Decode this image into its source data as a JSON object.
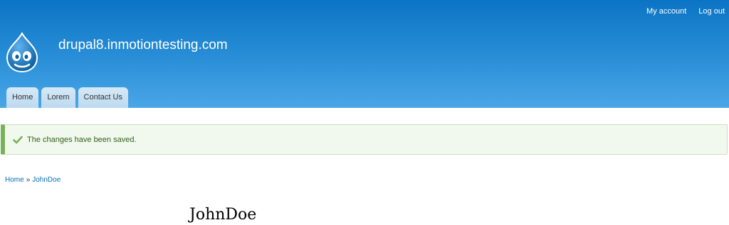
{
  "header": {
    "site_name": "drupal8.inmotiontesting.com",
    "logo_icon": "drupal-drop-logo",
    "secondary_menu": [
      {
        "label": "My account"
      },
      {
        "label": "Log out"
      }
    ],
    "primary_tabs": [
      {
        "label": "Home"
      },
      {
        "label": "Lorem"
      },
      {
        "label": "Contact Us"
      }
    ]
  },
  "status_message": {
    "icon": "check-icon",
    "text": "The changes have been saved."
  },
  "breadcrumb": {
    "items": [
      {
        "label": "Home"
      },
      {
        "label": "JohnDoe"
      }
    ],
    "separator": "»"
  },
  "page": {
    "title": "JohnDoe"
  },
  "colors": {
    "header_top": "#0b74c4",
    "header_bottom": "#4aa6e6",
    "tab_bg": "#c7e0f2",
    "message_border": "#77b259",
    "link": "#0071b3"
  }
}
